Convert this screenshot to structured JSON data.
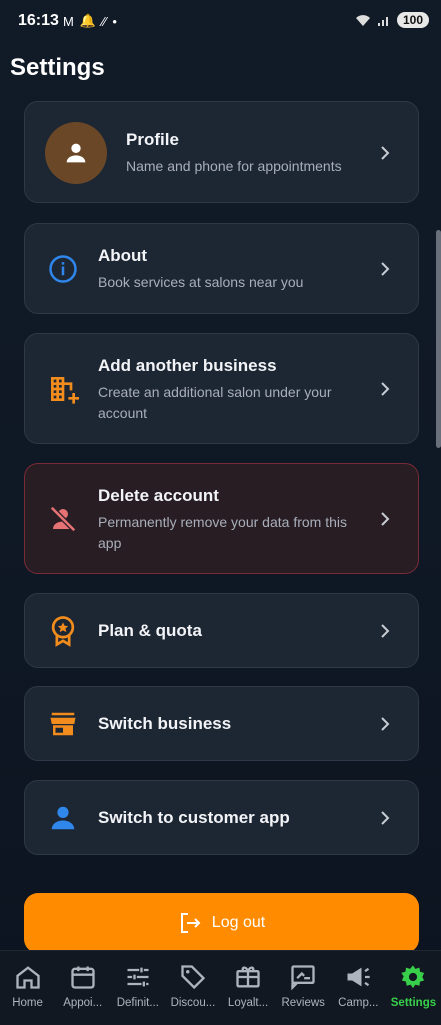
{
  "status_bar": {
    "time": "16:13",
    "battery": "100"
  },
  "page": {
    "title": "Settings"
  },
  "settings_items": [
    {
      "title": "Profile",
      "subtitle": "Name and phone for appointments",
      "icon": "person-icon"
    },
    {
      "title": "About",
      "subtitle": "Book services at salons near you",
      "icon": "info-icon"
    },
    {
      "title": "Add another business",
      "subtitle": "Create an additional salon under your account",
      "icon": "domain-add-icon"
    },
    {
      "title": "Delete account",
      "subtitle": "Permanently remove your data from this app",
      "icon": "person-off-icon"
    },
    {
      "title": "Plan & quota",
      "subtitle": "",
      "icon": "badge-icon"
    },
    {
      "title": "Switch business",
      "subtitle": "",
      "icon": "store-icon"
    },
    {
      "title": "Switch to customer app",
      "subtitle": "",
      "icon": "person-icon"
    }
  ],
  "logout": {
    "label": "Log out"
  },
  "bottom_nav": [
    {
      "label": "Home"
    },
    {
      "label": "Appoi..."
    },
    {
      "label": "Definit..."
    },
    {
      "label": "Discou..."
    },
    {
      "label": "Loyalt..."
    },
    {
      "label": "Reviews"
    },
    {
      "label": "Camp..."
    },
    {
      "label": "Settings"
    }
  ],
  "colors": {
    "accent": "#ff8c00",
    "active_nav": "#38d04a",
    "info_blue": "#2f86eb",
    "danger": "#e57373"
  }
}
